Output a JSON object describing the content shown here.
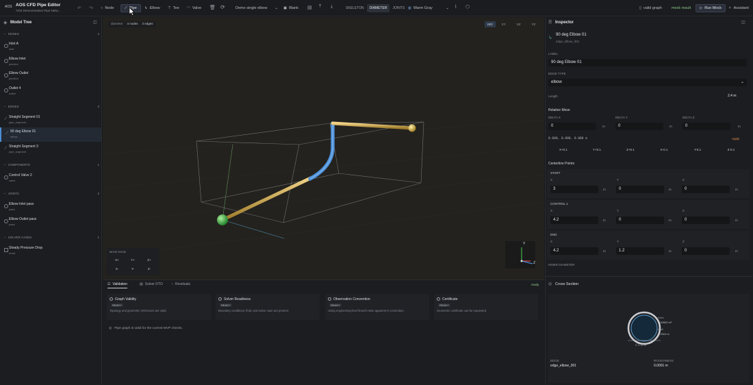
{
  "app": {
    "badge": "AOS",
    "title": "AOS CFD Pipe Editor",
    "subtitle": "AOS Demonstration Pipe Netw..."
  },
  "toolbar": {
    "node": "Node",
    "pipe": "Pipe",
    "elbow": "Elbow",
    "tee": "Tee",
    "valve": "Valve",
    "preset": "Demo single elbow",
    "blank": "Blank",
    "modes": [
      "SKELETON",
      "DIAMETER",
      "JOINTS"
    ],
    "active_mode": "DIAMETER",
    "theme": "Warm Gray",
    "valid": "valid graph",
    "mock": "mock result",
    "run": "Run Mock",
    "assistant": "Assistant"
  },
  "tree": {
    "title": "Model Tree",
    "sections": [
      {
        "label": "NODES",
        "count": "4",
        "items": [
          {
            "name": "Inlet A",
            "sub": "inlet"
          },
          {
            "name": "Elbow Inlet",
            "sub": "junction"
          },
          {
            "name": "Elbow Outlet",
            "sub": "junction"
          },
          {
            "name": "Outlet 4",
            "sub": "outlet"
          }
        ]
      },
      {
        "label": "EDGES",
        "count": "3",
        "items": [
          {
            "name": "Straight Segment 01",
            "sub": "pipe_segment"
          },
          {
            "name": "90 deg Elbow 01",
            "sub": "elbow"
          },
          {
            "name": "Straight Segment 3",
            "sub": "pipe_segment"
          }
        ]
      },
      {
        "label": "COMPONENTS",
        "count": "1",
        "items": [
          {
            "name": "Control Valve 2",
            "sub": "valve"
          }
        ]
      },
      {
        "label": "JOINTS",
        "count": "2",
        "items": [
          {
            "name": "Elbow Inlet pass",
            "sub": "pass"
          },
          {
            "name": "Elbow Outlet pass",
            "sub": "pass"
          }
        ]
      },
      {
        "label": "SOLVER CASES",
        "count": "1",
        "items": [
          {
            "name": "Steady Pressure Drop",
            "sub": "mock"
          }
        ]
      }
    ]
  },
  "viewport": {
    "mode": "diameter",
    "nodes": "4 nodes",
    "edges": "3 edges",
    "views": [
      "ISO",
      "XY",
      "XZ",
      "YZ"
    ],
    "active_view": "ISO",
    "move_edge": {
      "title": "MOVE EDGE",
      "row1": [
        "X+",
        "Y+",
        "Z+"
      ],
      "row2": [
        "X-",
        "Y-",
        "Z-"
      ]
    },
    "axes": {
      "y": "Y",
      "z": "Z"
    },
    "colors": {
      "pipe": "#d8b45a",
      "elbow": "#4a8fd9",
      "start_node": "#3fb54a",
      "end_node": "#d2b447"
    }
  },
  "bottom": {
    "tabs": [
      "Validation",
      "Solver DTO",
      "Residuals"
    ],
    "active_tab": "Validation",
    "status": "ready",
    "cards": [
      {
        "title": "Graph Validity",
        "status": "READY",
        "desc": "Topology and geometric references are valid."
      },
      {
        "title": "Solver Readiness",
        "status": "READY",
        "desc": "Boundary conditions, fluid, and solver case are present."
      },
      {
        "title": "Observation Convention",
        "status": "READY",
        "desc": "Using engineering-level branch-wise apparent K convention."
      },
      {
        "title": "Certificate",
        "status": "READY",
        "desc": "Geometric certificate can be requested."
      }
    ],
    "note": "Pipe graph is valid for the current MVP checks."
  },
  "inspector": {
    "title": "Inspector",
    "item_title": "90 deg Elbow 01",
    "item_id": "edge_elbow_001",
    "label_caption": "LABEL",
    "label_value": "90 deg Elbow 01",
    "edge_type_caption": "EDGE TYPE",
    "edge_type": "elbow",
    "length_caption": "Length",
    "length": "2.4 m",
    "relative_move": "Relative Move",
    "deltas": [
      {
        "label": "DELTA X",
        "value": "0",
        "unit": "m"
      },
      {
        "label": "DELTA Y",
        "value": "0",
        "unit": "m"
      },
      {
        "label": "DELTA Z",
        "value": "0",
        "unit": "m"
      }
    ],
    "delta_readout": "0.000, 0.000, 0.000 m",
    "apply": "Apply",
    "nudges": [
      "X+0.1",
      "Y+0.1",
      "Z+0.1",
      "X-0.1",
      "Y-0.1",
      "Z-0.1"
    ],
    "centerline": "Centerline Points",
    "points": [
      {
        "name": "START",
        "x": "3",
        "y": "0",
        "z": "0"
      },
      {
        "name": "CONTROL 1",
        "x": "4.2",
        "y": "0",
        "z": "0"
      },
      {
        "name": "END",
        "x": "4.2",
        "y": "1.2",
        "z": "0"
      }
    ],
    "axis_labels": [
      "X",
      "Y",
      "Z"
    ],
    "unit": "m",
    "inner_diameter": "INNER DIAMETER",
    "cross_section": "Cross Section",
    "area_label": "Area",
    "area_value": "0.00503 m²",
    "wall_label": "Wall",
    "wall_value": "0.2910 m",
    "dim": "D 0.08 m",
    "edge_caption": "EDGE",
    "edge_value": "edge_elbow_001",
    "rough_caption": "ROUGHNESS",
    "rough_value": "0.0001 m"
  }
}
